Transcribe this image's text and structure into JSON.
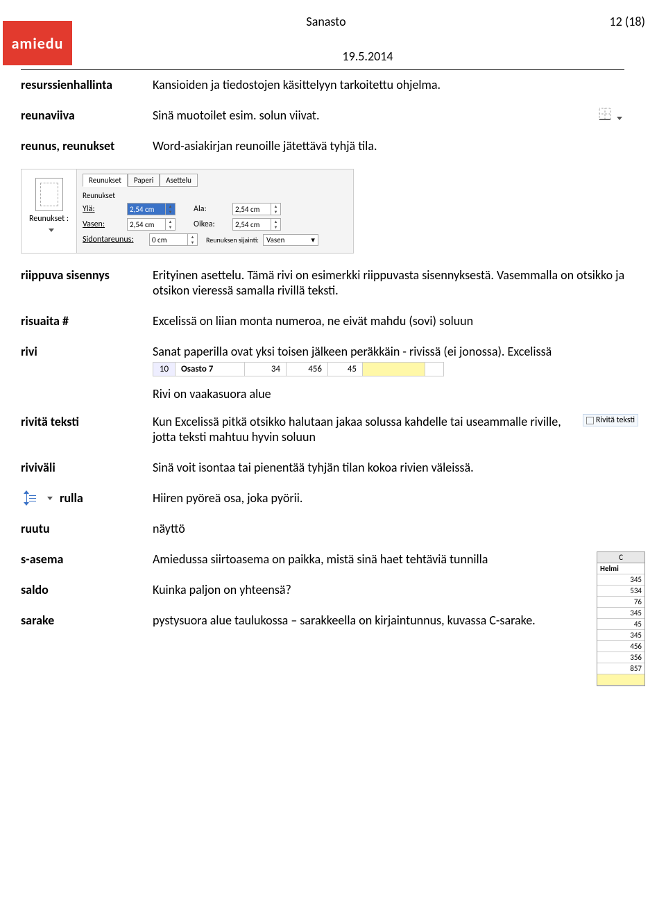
{
  "header": {
    "title": "Sanasto",
    "page": "12 (18)",
    "date": "19.5.2014",
    "logo": "amiedu"
  },
  "entries": {
    "resurssienhallinta": {
      "term": "resurssienhallinta",
      "def": "Kansioiden ja tiedostojen käsittelyyn tarkoitettu ohjelma."
    },
    "reunaviiva": {
      "term": "reunaviiva",
      "def": "Sinä muotoilet esim. solun viivat."
    },
    "reunus": {
      "term": "reunus, reunukset",
      "def": "Word-asiakirjan reunoille jätettävä tyhjä tila."
    },
    "riippuva": {
      "term": "riippuva sisennys",
      "def": "Erityinen asettelu. Tämä rivi on esimerkki riippuvasta sisennyksestä. Vasemmalla on otsikko ja otsikon vieressä samalla rivillä teksti."
    },
    "risuaita": {
      "term": "risuaita #",
      "def": "Excelissä on liian monta numeroa, ne eivät mahdu (sovi) soluun"
    },
    "rivi": {
      "term": "rivi",
      "def": "Sanat paperilla ovat yksi toisen jälkeen peräkkäin - rivissä (ei jonossa). Excelissä"
    },
    "rivi_extra": "Rivi on vaakasuora alue",
    "rivita": {
      "term": "rivitä teksti",
      "def": "Kun Excelissä pitkä otsikko halutaan jakaa solussa kahdelle tai useammalle riville, jotta teksti mahtuu hyvin soluun"
    },
    "rivivali": {
      "term": "riviväli",
      "def": "Sinä voit isontaa tai pienentää tyhjän tilan kokoa rivien väleissä."
    },
    "rulla": {
      "term": "rulla",
      "def": "Hiiren pyöreä osa, joka pyörii."
    },
    "ruutu": {
      "term": "ruutu",
      "def": "näyttö"
    },
    "sasema": {
      "term": "s-asema",
      "def": "Amiedussa siirtoasema on paikka, mistä sinä haet tehtäviä tunnilla"
    },
    "saldo": {
      "term": "saldo",
      "def": "Kuinka paljon on yhteensä?"
    },
    "sarake": {
      "term": "sarake",
      "def": "pystysuora alue taulukossa – sarakkeella on kirjaintunnus, kuvassa C-sarake."
    }
  },
  "dialog": {
    "side_label": "Reunukset :",
    "tab1": "Reunukset",
    "tab2": "Paperi",
    "tab3": "Asettelu",
    "section": "Reunukset",
    "yla": "Ylä:",
    "ala": "Ala:",
    "vasen": "Vasen:",
    "oikea": "Oikea:",
    "sidonta": "Sidontareunus:",
    "sijainti": "Reunuksen sijainti:",
    "v254": "2,54 cm",
    "v0": "0 cm",
    "vasen_opt": "Vasen"
  },
  "excelrow": {
    "rownum": "10",
    "a": "Osasto 7",
    "b": "34",
    "c": "456",
    "d": "45"
  },
  "rivita_btn": "Rivitä teksti",
  "col_c": {
    "header": "C",
    "bold": "Helmi",
    "vals": [
      "345",
      "534",
      "76",
      "345",
      "45",
      "345",
      "456",
      "356",
      "857"
    ]
  }
}
